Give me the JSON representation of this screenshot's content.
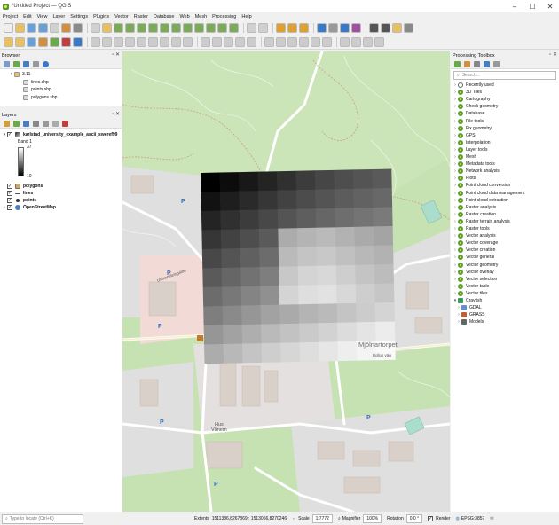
{
  "window": {
    "title": "*Untitled Project — QGIS",
    "controls": [
      "–",
      "☐",
      "✕"
    ]
  },
  "menu": [
    "Project",
    "Edit",
    "View",
    "Layer",
    "Settings",
    "Plugins",
    "Vector",
    "Raster",
    "Database",
    "Web",
    "Mesh",
    "Processing",
    "Help"
  ],
  "browser": {
    "title": "Browser",
    "items": [
      {
        "label": "3.11",
        "type": "folder"
      },
      {
        "label": "lines.shp",
        "type": "file"
      },
      {
        "label": "points.shp",
        "type": "file"
      },
      {
        "label": "polygons.shp",
        "type": "file"
      }
    ]
  },
  "layers": {
    "title": "Layers",
    "raster_layer": "karlstad_university_example_ascii_sweref99",
    "band": "Band 1",
    "legend_max": "37",
    "legend_min": "10",
    "items": [
      {
        "label": "polygons",
        "symbol": "#c8a878"
      },
      {
        "label": "lines",
        "symbol": "#555555"
      },
      {
        "label": "points",
        "symbol": "#333333"
      },
      {
        "label": "OpenStreetMap",
        "symbol": "#4a7dbf"
      }
    ]
  },
  "toolbox": {
    "title": "Processing Toolbox",
    "search_placeholder": "Search...",
    "items": [
      "Recently used",
      "3D Tiles",
      "Cartography",
      "Check geometry",
      "Database",
      "File tools",
      "Fix geometry",
      "GPS",
      "Interpolation",
      "Layer tools",
      "Mesh",
      "Metadata tools",
      "Network analysis",
      "Plots",
      "Point cloud conversion",
      "Point cloud data management",
      "Point cloud extraction",
      "Raster analysis",
      "Raster creation",
      "Raster terrain analysis",
      "Raster tools",
      "Vector analysis",
      "Vector coverage",
      "Vector creation",
      "Vector general",
      "Vector geometry",
      "Vector overlay",
      "Vector selection",
      "Vector table",
      "Vector tiles"
    ],
    "providers": [
      "Crayfish",
      "GDAL",
      "GRASS",
      "Models"
    ]
  },
  "map": {
    "labels": {
      "university": "Universitetsgatan",
      "mjolnartorpet": "Mjölnartorpet",
      "bollus": "Bollus väg",
      "hus_vanern_1": "Hus",
      "hus_vanern_2": "Vänern"
    },
    "raster_grid": [
      [
        0,
        12,
        24,
        36,
        48,
        60,
        70,
        78,
        84,
        90
      ],
      [
        18,
        30,
        42,
        54,
        66,
        76,
        84,
        92,
        98,
        104
      ],
      [
        36,
        48,
        60,
        72,
        84,
        94,
        102,
        110,
        116,
        122
      ],
      [
        54,
        66,
        78,
        90,
        172,
        180,
        186,
        178,
        170,
        164
      ],
      [
        72,
        84,
        96,
        108,
        186,
        196,
        200,
        192,
        184,
        178
      ],
      [
        90,
        102,
        114,
        126,
        200,
        212,
        216,
        206,
        196,
        188
      ],
      [
        108,
        120,
        132,
        144,
        212,
        222,
        226,
        216,
        206,
        198
      ],
      [
        126,
        138,
        150,
        162,
        170,
        180,
        186,
        196,
        204,
        212
      ],
      [
        150,
        162,
        174,
        186,
        194,
        202,
        210,
        220,
        228,
        236
      ],
      [
        172,
        184,
        196,
        206,
        214,
        222,
        230,
        238,
        244,
        250
      ]
    ]
  },
  "statusbar": {
    "locate_placeholder": "Type to locate (Ctrl+K)",
    "extents_label": "Extents",
    "extents_value": "1511386,8267869 : 1513066,8270246",
    "scale_label": "Scale",
    "scale_value": "1:7772",
    "magnifier_label": "Magnifier",
    "magnifier_value": "100%",
    "rotation_label": "Rotation",
    "rotation_value": "0.0 °",
    "render_label": "Render",
    "crs": "EPSG:3857"
  }
}
